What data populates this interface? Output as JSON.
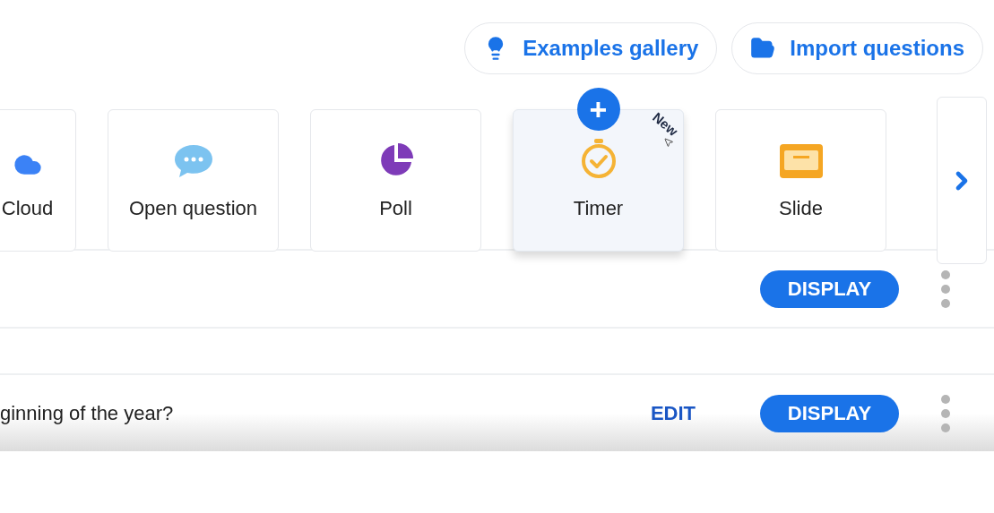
{
  "header_buttons": [
    {
      "kind": "bulb",
      "label": "Examples gallery"
    },
    {
      "kind": "folder",
      "label": "Import questions"
    }
  ],
  "question_types": [
    {
      "kind": "cloud",
      "label": "Cloud",
      "selected": false,
      "new": false
    },
    {
      "kind": "chat",
      "label": "Open question",
      "selected": false,
      "new": false
    },
    {
      "kind": "pie",
      "label": "Poll",
      "selected": false,
      "new": false
    },
    {
      "kind": "timer",
      "label": "Timer",
      "selected": true,
      "new": true,
      "badge": "New"
    },
    {
      "kind": "slide",
      "label": "Slide",
      "selected": false,
      "new": false
    }
  ],
  "add_button": "+",
  "questions": [
    {
      "display": "DISPLAY"
    },
    {
      "text": "ginning of the year?",
      "edit": "EDIT",
      "display": "DISPLAY"
    }
  ]
}
